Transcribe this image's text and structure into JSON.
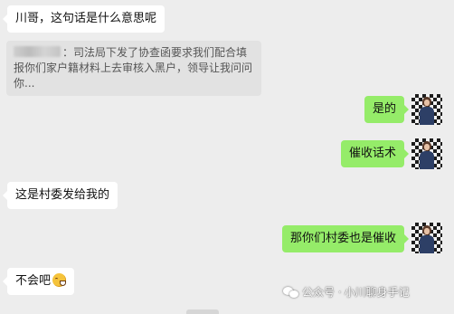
{
  "chat": {
    "messages": [
      {
        "side": "left",
        "text": "川哥，这句话是什么意思呢"
      },
      {
        "side": "left",
        "type": "quote",
        "text": "：司法局下发了协查函要求我们配合填报你们家户籍材料上去审核入黑户，领导让我问问你..."
      },
      {
        "side": "right",
        "text": "是的"
      },
      {
        "side": "right",
        "text": "催收话术"
      },
      {
        "side": "left",
        "text": "这是村委发给我的"
      },
      {
        "side": "right",
        "text": "那你们村委也是催收"
      },
      {
        "side": "left",
        "text": "不会吧"
      }
    ]
  },
  "watermark": {
    "prefix": "公众号 · ",
    "name": "小川聊身手记"
  },
  "colors": {
    "background": "#ededed",
    "left_bubble": "#ffffff",
    "right_bubble": "#95ec69",
    "quote_bg": "#e2e2e2"
  },
  "icons": {
    "avatar": "user-avatar-icon",
    "emoji": "grinning-sweat-emoji-icon",
    "watermark": "wechat-channel-icon"
  }
}
